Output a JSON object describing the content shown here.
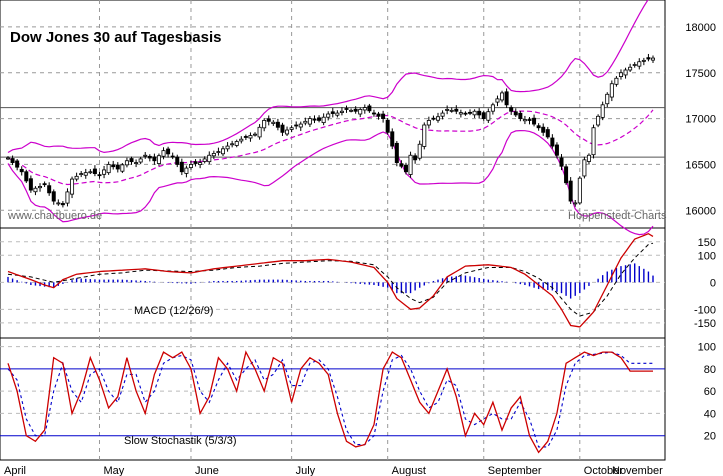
{
  "chart_data": [
    {
      "type": "candlestick",
      "title": "Dow Jones 30 auf Tagesbasis",
      "watermark_left": "www.chartbuero.de",
      "watermark_right": "Hoppenstedt-Charts",
      "y_ticks": [
        "18000",
        "17500",
        "17000",
        "16500",
        "16000"
      ],
      "ylim": [
        15850,
        18250
      ],
      "reference_lines": [
        17120,
        16580
      ],
      "close_points": [
        [
          0,
          16570
        ],
        [
          3,
          16420
        ],
        [
          5,
          16220
        ],
        [
          8,
          16280
        ],
        [
          10,
          16100
        ],
        [
          12,
          16060
        ],
        [
          14,
          16340
        ],
        [
          16,
          16400
        ],
        [
          18,
          16420
        ],
        [
          20,
          16380
        ],
        [
          22,
          16500
        ],
        [
          24,
          16450
        ],
        [
          26,
          16540
        ],
        [
          28,
          16520
        ],
        [
          30,
          16600
        ],
        [
          32,
          16540
        ],
        [
          34,
          16650
        ],
        [
          36,
          16580
        ],
        [
          38,
          16420
        ],
        [
          40,
          16500
        ],
        [
          42,
          16520
        ],
        [
          44,
          16600
        ],
        [
          46,
          16640
        ],
        [
          48,
          16700
        ],
        [
          50,
          16750
        ],
        [
          52,
          16800
        ],
        [
          54,
          16830
        ],
        [
          56,
          16980
        ],
        [
          58,
          16960
        ],
        [
          60,
          16850
        ],
        [
          62,
          16900
        ],
        [
          64,
          16940
        ],
        [
          66,
          17000
        ],
        [
          68,
          16980
        ],
        [
          70,
          17050
        ],
        [
          72,
          17060
        ],
        [
          74,
          17100
        ],
        [
          76,
          17080
        ],
        [
          78,
          17120
        ],
        [
          80,
          17050
        ],
        [
          82,
          17000
        ],
        [
          84,
          16700
        ],
        [
          85,
          16520
        ],
        [
          86,
          16480
        ],
        [
          87,
          16420
        ],
        [
          88,
          16600
        ],
        [
          89,
          16550
        ],
        [
          90,
          16720
        ],
        [
          91,
          16930
        ],
        [
          92,
          16980
        ],
        [
          94,
          17020
        ],
        [
          96,
          17100
        ],
        [
          98,
          17080
        ],
        [
          100,
          17050
        ],
        [
          102,
          17080
        ],
        [
          104,
          17000
        ],
        [
          106,
          17150
        ],
        [
          108,
          17280
        ],
        [
          109,
          17150
        ],
        [
          110,
          17080
        ],
        [
          112,
          17000
        ],
        [
          114,
          16980
        ],
        [
          116,
          16900
        ],
        [
          118,
          16800
        ],
        [
          120,
          16600
        ],
        [
          121,
          16480
        ],
        [
          122,
          16300
        ],
        [
          123,
          16100
        ],
        [
          124,
          16080
        ],
        [
          125,
          16350
        ],
        [
          126,
          16550
        ],
        [
          127,
          16600
        ],
        [
          128,
          16900
        ],
        [
          130,
          17150
        ],
        [
          132,
          17380
        ],
        [
          134,
          17500
        ],
        [
          136,
          17560
        ],
        [
          138,
          17620
        ],
        [
          140,
          17650
        ],
        [
          141,
          17660
        ]
      ]
    },
    {
      "type": "line",
      "label": "MACD (12/26/9)",
      "y_ticks": [
        "150",
        "100",
        "0",
        "-100",
        "-150"
      ],
      "ylim": [
        -195,
        190
      ],
      "series": [
        {
          "color": "#cc0000",
          "style": "solid"
        },
        {
          "color": "#000000",
          "style": "dashed"
        },
        {
          "color": "#0000cc",
          "style": "histogram"
        }
      ],
      "macd": [
        [
          0,
          40
        ],
        [
          5,
          10
        ],
        [
          8,
          -10
        ],
        [
          10,
          -20
        ],
        [
          12,
          10
        ],
        [
          15,
          30
        ],
        [
          20,
          40
        ],
        [
          25,
          45
        ],
        [
          30,
          50
        ],
        [
          35,
          40
        ],
        [
          40,
          35
        ],
        [
          45,
          50
        ],
        [
          50,
          60
        ],
        [
          55,
          70
        ],
        [
          60,
          80
        ],
        [
          65,
          80
        ],
        [
          70,
          85
        ],
        [
          75,
          75
        ],
        [
          80,
          55
        ],
        [
          83,
          0
        ],
        [
          85,
          -60
        ],
        [
          88,
          -100
        ],
        [
          90,
          -95
        ],
        [
          93,
          -50
        ],
        [
          96,
          20
        ],
        [
          100,
          60
        ],
        [
          105,
          65
        ],
        [
          110,
          55
        ],
        [
          113,
          30
        ],
        [
          116,
          -10
        ],
        [
          119,
          -50
        ],
        [
          121,
          -100
        ],
        [
          123,
          -160
        ],
        [
          125,
          -165
        ],
        [
          128,
          -110
        ],
        [
          131,
          -10
        ],
        [
          134,
          90
        ],
        [
          137,
          160
        ],
        [
          140,
          180
        ],
        [
          141,
          170
        ]
      ],
      "signal": [
        [
          0,
          30
        ],
        [
          5,
          20
        ],
        [
          10,
          0
        ],
        [
          15,
          15
        ],
        [
          20,
          30
        ],
        [
          25,
          35
        ],
        [
          30,
          45
        ],
        [
          35,
          42
        ],
        [
          40,
          40
        ],
        [
          45,
          45
        ],
        [
          50,
          55
        ],
        [
          55,
          60
        ],
        [
          60,
          70
        ],
        [
          65,
          75
        ],
        [
          70,
          80
        ],
        [
          75,
          78
        ],
        [
          80,
          65
        ],
        [
          83,
          20
        ],
        [
          85,
          -20
        ],
        [
          88,
          -60
        ],
        [
          90,
          -75
        ],
        [
          93,
          -55
        ],
        [
          96,
          0
        ],
        [
          100,
          35
        ],
        [
          105,
          55
        ],
        [
          110,
          55
        ],
        [
          113,
          40
        ],
        [
          116,
          15
        ],
        [
          119,
          -20
        ],
        [
          121,
          -60
        ],
        [
          123,
          -100
        ],
        [
          125,
          -125
        ],
        [
          128,
          -110
        ],
        [
          131,
          -50
        ],
        [
          134,
          30
        ],
        [
          137,
          90
        ],
        [
          140,
          140
        ],
        [
          141,
          145
        ]
      ],
      "histogram": [
        [
          0,
          20
        ],
        [
          5,
          -10
        ],
        [
          10,
          -20
        ],
        [
          15,
          15
        ],
        [
          20,
          10
        ],
        [
          25,
          10
        ],
        [
          30,
          5
        ],
        [
          35,
          -2
        ],
        [
          40,
          -5
        ],
        [
          45,
          5
        ],
        [
          50,
          5
        ],
        [
          55,
          10
        ],
        [
          60,
          10
        ],
        [
          65,
          5
        ],
        [
          70,
          5
        ],
        [
          75,
          -3
        ],
        [
          80,
          -10
        ],
        [
          83,
          -20
        ],
        [
          85,
          -40
        ],
        [
          88,
          -40
        ],
        [
          90,
          -20
        ],
        [
          93,
          5
        ],
        [
          96,
          20
        ],
        [
          100,
          25
        ],
        [
          105,
          10
        ],
        [
          110,
          0
        ],
        [
          113,
          -10
        ],
        [
          116,
          -25
        ],
        [
          119,
          -30
        ],
        [
          121,
          -40
        ],
        [
          123,
          -60
        ],
        [
          125,
          -40
        ],
        [
          128,
          0
        ],
        [
          131,
          40
        ],
        [
          134,
          60
        ],
        [
          137,
          70
        ],
        [
          140,
          40
        ],
        [
          141,
          25
        ]
      ]
    },
    {
      "type": "line",
      "label": "Slow Stochastik (5/3/3)",
      "y_ticks": [
        "100",
        "80",
        "60",
        "40",
        "20"
      ],
      "ylim": [
        0,
        105
      ],
      "hlines": [
        80,
        20
      ],
      "k": [
        [
          0,
          85
        ],
        [
          2,
          60
        ],
        [
          4,
          20
        ],
        [
          6,
          15
        ],
        [
          8,
          25
        ],
        [
          10,
          90
        ],
        [
          12,
          85
        ],
        [
          14,
          40
        ],
        [
          16,
          60
        ],
        [
          18,
          90
        ],
        [
          20,
          70
        ],
        [
          22,
          45
        ],
        [
          24,
          55
        ],
        [
          26,
          90
        ],
        [
          28,
          60
        ],
        [
          30,
          40
        ],
        [
          32,
          75
        ],
        [
          34,
          95
        ],
        [
          36,
          90
        ],
        [
          38,
          95
        ],
        [
          40,
          80
        ],
        [
          42,
          40
        ],
        [
          44,
          55
        ],
        [
          46,
          90
        ],
        [
          48,
          80
        ],
        [
          50,
          60
        ],
        [
          52,
          95
        ],
        [
          54,
          80
        ],
        [
          56,
          60
        ],
        [
          58,
          90
        ],
        [
          60,
          85
        ],
        [
          62,
          50
        ],
        [
          64,
          80
        ],
        [
          66,
          90
        ],
        [
          68,
          85
        ],
        [
          70,
          75
        ],
        [
          72,
          40
        ],
        [
          74,
          15
        ],
        [
          76,
          10
        ],
        [
          78,
          12
        ],
        [
          80,
          30
        ],
        [
          82,
          80
        ],
        [
          84,
          95
        ],
        [
          86,
          90
        ],
        [
          88,
          70
        ],
        [
          90,
          50
        ],
        [
          92,
          40
        ],
        [
          94,
          60
        ],
        [
          96,
          80
        ],
        [
          98,
          55
        ],
        [
          100,
          20
        ],
        [
          102,
          40
        ],
        [
          104,
          30
        ],
        [
          106,
          50
        ],
        [
          108,
          25
        ],
        [
          110,
          45
        ],
        [
          112,
          55
        ],
        [
          114,
          20
        ],
        [
          116,
          5
        ],
        [
          118,
          15
        ],
        [
          120,
          40
        ],
        [
          122,
          85
        ],
        [
          124,
          90
        ],
        [
          126,
          95
        ],
        [
          128,
          92
        ],
        [
          130,
          95
        ],
        [
          132,
          95
        ],
        [
          134,
          90
        ],
        [
          136,
          78
        ]
      ],
      "d": [
        [
          0,
          80
        ],
        [
          2,
          70
        ],
        [
          4,
          35
        ],
        [
          6,
          20
        ],
        [
          8,
          20
        ],
        [
          10,
          60
        ],
        [
          12,
          85
        ],
        [
          14,
          60
        ],
        [
          16,
          50
        ],
        [
          18,
          75
        ],
        [
          20,
          80
        ],
        [
          22,
          60
        ],
        [
          24,
          50
        ],
        [
          26,
          75
        ],
        [
          28,
          75
        ],
        [
          30,
          50
        ],
        [
          32,
          60
        ],
        [
          34,
          85
        ],
        [
          36,
          90
        ],
        [
          38,
          92
        ],
        [
          40,
          88
        ],
        [
          42,
          60
        ],
        [
          44,
          50
        ],
        [
          46,
          70
        ],
        [
          48,
          85
        ],
        [
          50,
          70
        ],
        [
          52,
          80
        ],
        [
          54,
          88
        ],
        [
          56,
          70
        ],
        [
          58,
          75
        ],
        [
          60,
          88
        ],
        [
          62,
          65
        ],
        [
          64,
          65
        ],
        [
          66,
          85
        ],
        [
          68,
          88
        ],
        [
          70,
          80
        ],
        [
          72,
          55
        ],
        [
          74,
          25
        ],
        [
          76,
          12
        ],
        [
          78,
          12
        ],
        [
          80,
          20
        ],
        [
          82,
          60
        ],
        [
          84,
          88
        ],
        [
          86,
          92
        ],
        [
          88,
          80
        ],
        [
          90,
          60
        ],
        [
          92,
          45
        ],
        [
          94,
          50
        ],
        [
          96,
          70
        ],
        [
          98,
          65
        ],
        [
          100,
          35
        ],
        [
          102,
          30
        ],
        [
          104,
          35
        ],
        [
          106,
          40
        ],
        [
          108,
          35
        ],
        [
          110,
          35
        ],
        [
          112,
          50
        ],
        [
          114,
          35
        ],
        [
          116,
          10
        ],
        [
          118,
          10
        ],
        [
          120,
          25
        ],
        [
          122,
          65
        ],
        [
          124,
          85
        ],
        [
          126,
          92
        ],
        [
          128,
          93
        ],
        [
          130,
          94
        ],
        [
          132,
          95
        ],
        [
          134,
          92
        ],
        [
          136,
          85
        ]
      ]
    }
  ],
  "x_axis": {
    "months": [
      "April",
      "May",
      "June",
      "July",
      "August",
      "September",
      "October",
      "November"
    ]
  }
}
